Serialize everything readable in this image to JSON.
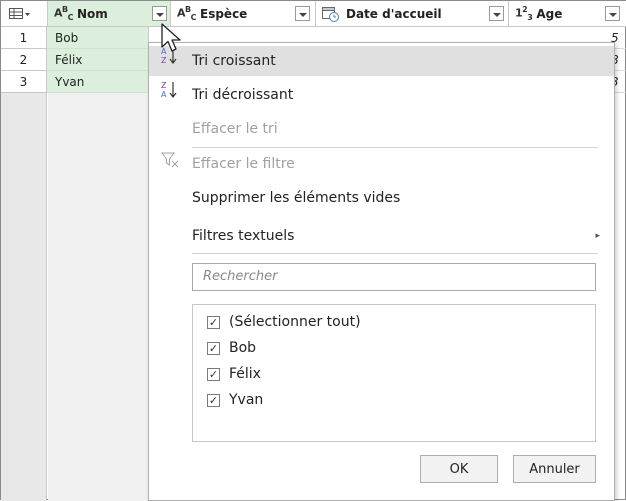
{
  "columns": [
    {
      "type_icon": "ABC",
      "label": "Nom"
    },
    {
      "type_icon": "ABC",
      "label": "Espèce"
    },
    {
      "type_icon": "calendar-clock",
      "label": "Date d'accueil"
    },
    {
      "type_icon": "123",
      "label": "Age"
    }
  ],
  "rows": [
    {
      "num": "1",
      "nom": "Bob",
      "age": "5"
    },
    {
      "num": "2",
      "nom": "Félix",
      "age": "8"
    },
    {
      "num": "3",
      "nom": "Yvan",
      "age": "3"
    }
  ],
  "menu": {
    "sort_asc": "Tri croissant",
    "sort_desc": "Tri décroissant",
    "clear_sort": "Effacer le tri",
    "clear_filter": "Effacer le filtre",
    "remove_empty": "Supprimer les éléments vides",
    "text_filters": "Filtres textuels",
    "search_placeholder": "Rechercher",
    "options": [
      {
        "label": "(Sélectionner tout)",
        "checked": true
      },
      {
        "label": "Bob",
        "checked": true
      },
      {
        "label": "Félix",
        "checked": true
      },
      {
        "label": "Yvan",
        "checked": true
      }
    ],
    "ok_label": "OK",
    "cancel_label": "Annuler"
  },
  "colors": {
    "selected_column": "#dcefdc",
    "highlight": "#e0e0e0",
    "sort_icon": "#4472c4"
  }
}
